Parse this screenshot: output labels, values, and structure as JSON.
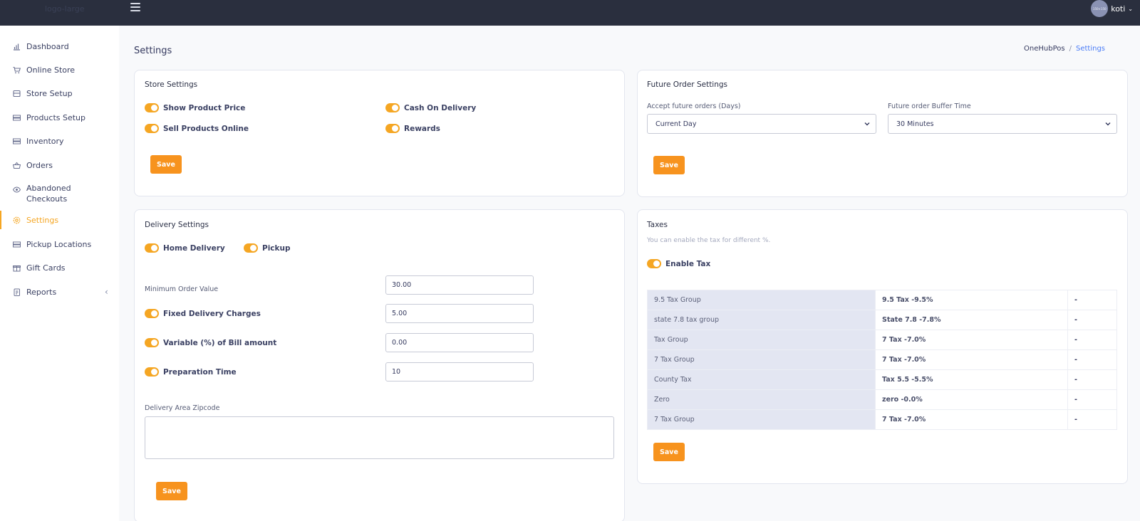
{
  "topbar": {
    "logo_text": "logo-large",
    "user_name": "koti",
    "avatar_text": "150×150"
  },
  "sidebar": {
    "items": [
      {
        "label": "Dashboard",
        "icon": "bar-chart-icon"
      },
      {
        "label": "Online Store",
        "icon": "cart-icon"
      },
      {
        "label": "Store Setup",
        "icon": "store-icon"
      },
      {
        "label": "Products Setup",
        "icon": "list-icon"
      },
      {
        "label": "Inventory",
        "icon": "list-icon"
      },
      {
        "label": "Orders",
        "icon": "basket-icon"
      },
      {
        "label": "Abandoned Checkouts",
        "icon": "eye-icon"
      },
      {
        "label": "Settings",
        "icon": "gear-icon",
        "active": true
      },
      {
        "label": "Pickup Locations",
        "icon": "list-icon"
      },
      {
        "label": "Gift Cards",
        "icon": "gift-icon"
      },
      {
        "label": "Reports",
        "icon": "reports-icon"
      }
    ],
    "chevron": "‹"
  },
  "page": {
    "title": "Settings",
    "breadcrumb": [
      "OneHubPos",
      "Settings"
    ],
    "breadcrumb_sep": "/"
  },
  "store_settings": {
    "title": "Store Settings",
    "toggles": [
      "Show Product Price",
      "Cash On Delivery",
      "Sell Products Online",
      "Rewards"
    ],
    "save_label": "Save"
  },
  "future_order": {
    "title": "Future Order Settings",
    "accept_label": "Accept future orders (Days)",
    "accept_value": "Current Day",
    "buffer_label": "Future order Buffer Time",
    "buffer_value": "30 Minutes",
    "save_label": "Save"
  },
  "delivery": {
    "title": "Delivery Settings",
    "home_delivery": "Home Delivery",
    "pickup": "Pickup",
    "min_order_label": "Minimum Order Value",
    "min_order_value": "30.00",
    "fixed_label": "Fixed Delivery Charges",
    "fixed_value": "5.00",
    "variable_label": "Variable (%) of Bill amount",
    "variable_value": "0.00",
    "prep_label": "Preparation Time",
    "prep_value": "10",
    "zipcode_label": "Delivery Area Zipcode",
    "save_label": "Save"
  },
  "taxes": {
    "title": "Taxes",
    "subtitle": "You can enable the tax for different %.",
    "enable_label": "Enable Tax",
    "rows": [
      {
        "group": "9.5 Tax Group",
        "tax": "9.5 Tax -9.5%",
        "action": "-"
      },
      {
        "group": "state 7.8 tax group",
        "tax": "State 7.8 -7.8%",
        "action": "-"
      },
      {
        "group": "Tax Group",
        "tax": "7 Tax -7.0%",
        "action": "-"
      },
      {
        "group": "7 Tax Group",
        "tax": "7 Tax -7.0%",
        "action": "-"
      },
      {
        "group": "County Tax",
        "tax": "Tax 5.5 -5.5%",
        "action": "-"
      },
      {
        "group": "Zero",
        "tax": "zero -0.0%",
        "action": "-"
      },
      {
        "group": "7 Tax Group",
        "tax": "7 Tax -7.0%",
        "action": "-"
      }
    ],
    "save_label": "Save"
  },
  "colors": {
    "accent": "#f5a623",
    "button": "#f7931e",
    "topbar": "#2a2f3e",
    "link": "#4a7cf7"
  }
}
